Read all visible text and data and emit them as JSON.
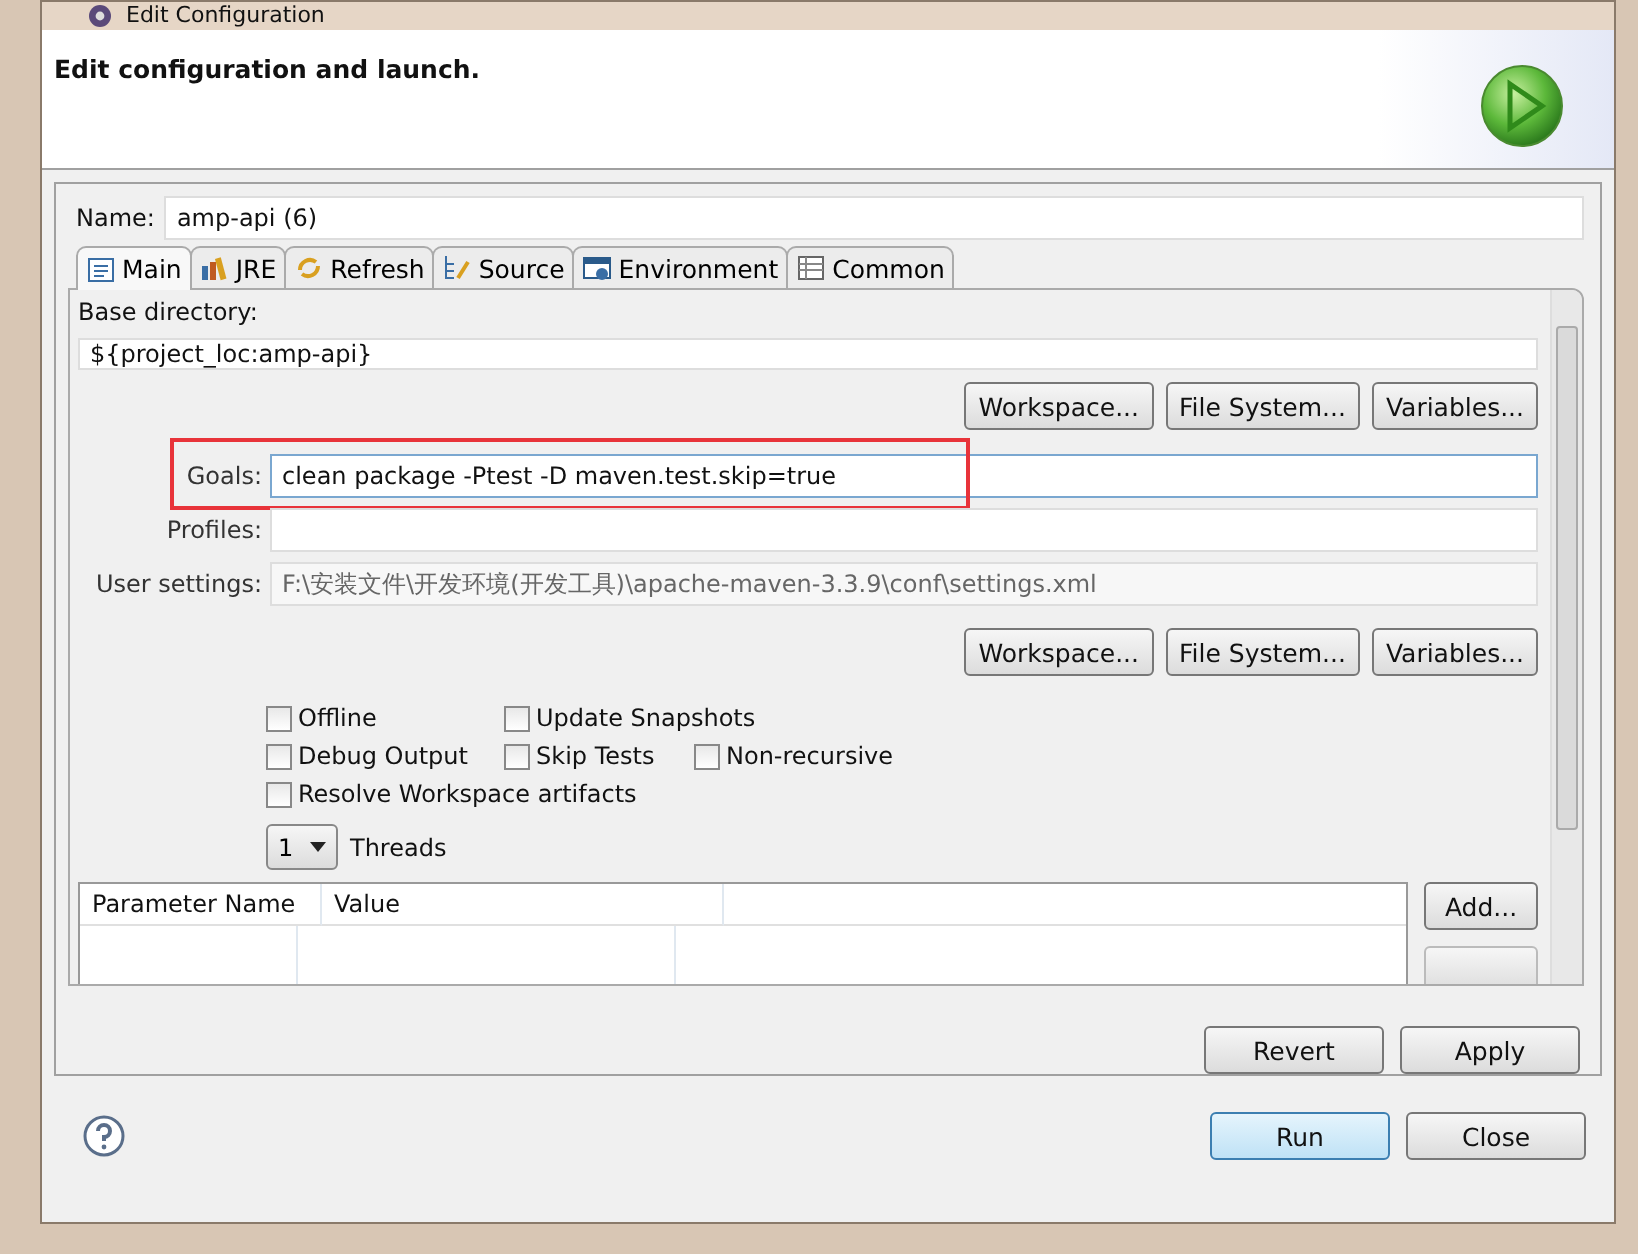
{
  "window": {
    "title": "Edit Configuration"
  },
  "header": {
    "title": "Edit configuration and launch."
  },
  "name_field": {
    "label": "Name:",
    "value": "amp-api (6)"
  },
  "tabs": [
    {
      "label": "Main",
      "selected": true
    },
    {
      "label": "JRE",
      "selected": false
    },
    {
      "label": "Refresh",
      "selected": false
    },
    {
      "label": "Source",
      "selected": false
    },
    {
      "label": "Environment",
      "selected": false
    },
    {
      "label": "Common",
      "selected": false
    }
  ],
  "main": {
    "base_directory": {
      "label": "Base directory:",
      "value": "${project_loc:amp-api}",
      "buttons": [
        "Workspace...",
        "File System...",
        "Variables..."
      ]
    },
    "goals": {
      "label": "Goals:",
      "value": "clean package -Ptest -D maven.test.skip=true",
      "highlighted": true
    },
    "profiles": {
      "label": "Profiles:"
    },
    "user_settings": {
      "label": "User settings:",
      "value": "F:\\安装文件\\开发环境(开发工具)\\apache-maven-3.3.9\\conf\\settings.xml",
      "buttons": [
        "Workspace...",
        "File System...",
        "Variables..."
      ]
    },
    "option_rows": [
      [
        {
          "label": "Offline",
          "checked": false
        },
        {
          "label": "Update Snapshots",
          "checked": false
        }
      ],
      [
        {
          "label": "Debug Output",
          "checked": false
        },
        {
          "label": "Skip Tests",
          "checked": false
        },
        {
          "label": "Non-recursive",
          "checked": false
        }
      ],
      [
        {
          "label": "Resolve Workspace artifacts",
          "checked": false
        }
      ]
    ],
    "threads": {
      "value": "1",
      "label": "Threads"
    },
    "parameters_table": {
      "columns": [
        "Parameter Name",
        "Value"
      ]
    },
    "table_buttons": [
      {
        "label": "Add...",
        "disabled": false
      },
      {
        "disabled": true
      }
    ]
  },
  "actions": [
    "Revert",
    "Apply"
  ],
  "footer_buttons": [
    {
      "label": "Run",
      "default": true
    },
    {
      "label": "Close",
      "default": false
    }
  ]
}
